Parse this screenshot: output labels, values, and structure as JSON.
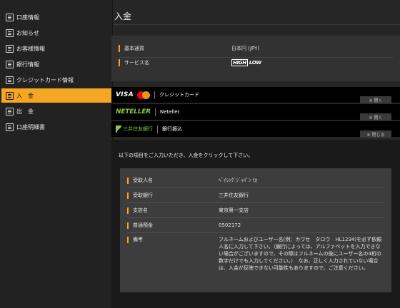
{
  "sidebar": {
    "items": [
      {
        "label": "口座情報"
      },
      {
        "label": "お知らせ"
      },
      {
        "label": "お客様情報"
      },
      {
        "label": "銀行情報"
      },
      {
        "label": "クレジットカード情報"
      },
      {
        "label": "入　金"
      },
      {
        "label": "出　金"
      },
      {
        "label": "口座明細書"
      }
    ],
    "active_index": 5
  },
  "header": {
    "title": "入金"
  },
  "account_info": {
    "rows": [
      {
        "label": "基本通貨",
        "value": "日本円 (JPY)"
      },
      {
        "label": "サービス名",
        "logo_high": "HIGH",
        "logo_low": "LOW"
      }
    ]
  },
  "methods": [
    {
      "brand": "VISA",
      "label": "クレジットカード",
      "toggle": "※ 開く"
    },
    {
      "brand": "NETELLER",
      "label": "Neteller",
      "toggle": "※ 開く"
    },
    {
      "brand": "三井住友銀行",
      "label": "銀行振込",
      "toggle": "※ 閉じる"
    }
  ],
  "bank_transfer": {
    "instruction": "以下の項目をご入力いただき、入金をクリックして下さい。",
    "rows": [
      {
        "label": "受取人名",
        "value": "ﾍﾞｲｼﾝｸﾞｼﾞｬﾊﾟﾝ (ｶ"
      },
      {
        "label": "受取銀行",
        "value": "三井住友銀行"
      },
      {
        "label": "支店名",
        "value": "東京第一支店"
      },
      {
        "label": "普通預金",
        "value": "0502172"
      },
      {
        "label": "備考",
        "value": "フルネームおよびユーザー名(例：カワセ　タロウ　HL1234)を必ず依頼人名に入力して下さい。（銀行によっては、アルファベットを入力できない場合がございますので、その際はフルネームの後にユーザー名の4桁の数字だけでも入力してください。）　なお、正しく入力されていない場合は、入金が反映できない可能性もありますので、ご注意ください。"
      }
    ]
  },
  "colors": {
    "accent": "#f5a623",
    "background": "#262626",
    "neteller_green": "#8dc63f"
  }
}
